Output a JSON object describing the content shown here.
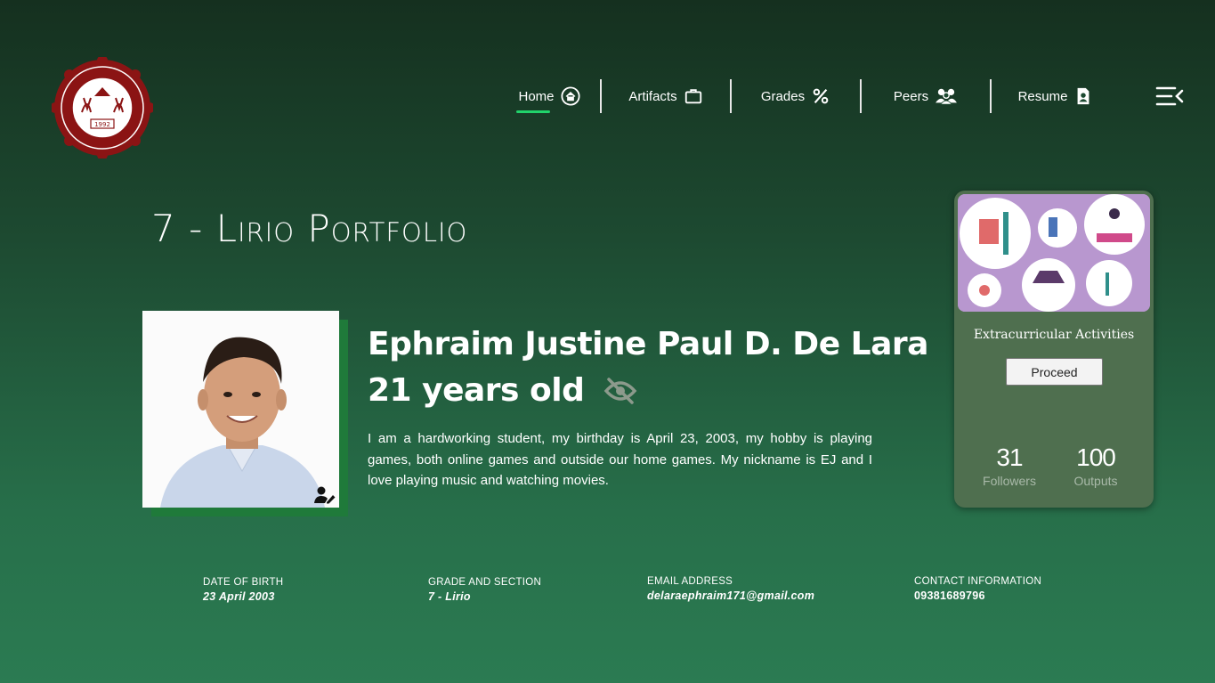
{
  "logo": {
    "icon": "university-seal-icon",
    "text": "1992"
  },
  "nav": {
    "items": [
      {
        "label": "Home",
        "icon": "home-icon"
      },
      {
        "label": "Artifacts",
        "icon": "briefcase-icon"
      },
      {
        "label": "Grades",
        "icon": "percent-icon"
      },
      {
        "label": "Peers",
        "icon": "group-icon"
      },
      {
        "label": "Resume",
        "icon": "document-user-icon"
      }
    ],
    "active": "Home",
    "menu_icon": "menu-icon"
  },
  "page": {
    "title": "7 - Lirio Portfolio"
  },
  "profile": {
    "name": "Ephraim Justine Paul D. De Lara",
    "age": "21 years old",
    "bio": "I am a hardworking student, my birthday is April 23, 2003, my hobby is playing games, both online games and outside our home games.  My nickname is EJ and I love playing music and watching movies."
  },
  "card": {
    "title": "Extracurricular Activities",
    "button": "Proceed",
    "stats": [
      {
        "value": "31",
        "label": "Followers"
      },
      {
        "value": "100",
        "label": "Outputs"
      }
    ]
  },
  "details": [
    {
      "label": "DATE OF BIRTH",
      "value": "23 April 2003"
    },
    {
      "label": "GRADE AND SECTION",
      "value": "7 - Lirio"
    },
    {
      "label": "EMAIL ADDRESS",
      "value": "delaraephraim171@gmail.com"
    },
    {
      "label": "CONTACT INFORMATION",
      "value": "09381689796"
    }
  ],
  "colors": {
    "accent": "#21d36b",
    "card_bg": "#4f6f4f",
    "card_image_bg": "#b897cf"
  }
}
